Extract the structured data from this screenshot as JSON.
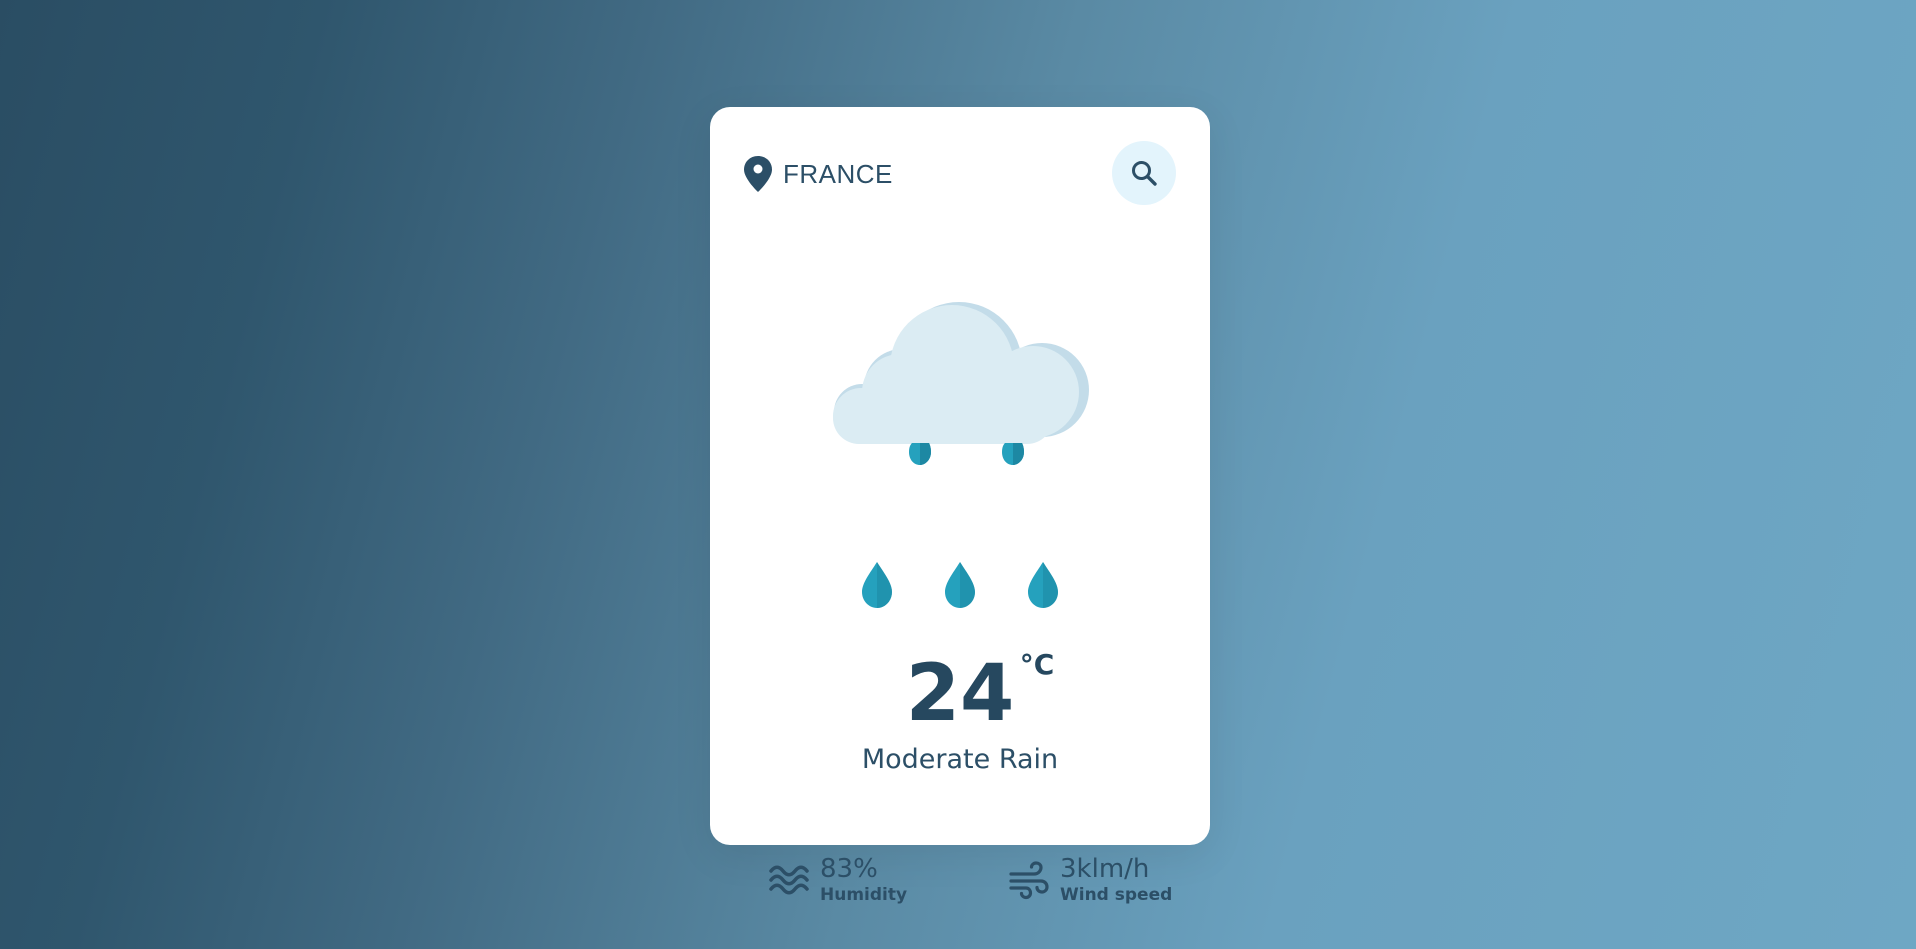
{
  "location": {
    "name": "FRANCE",
    "icon": "map-pin-icon"
  },
  "search": {
    "icon": "search-icon"
  },
  "weather": {
    "icon": "rain-cloud-icon",
    "temperature": "24",
    "unit": "°C",
    "description": "Moderate Rain"
  },
  "humidity": {
    "icon": "humidity-waves-icon",
    "value": "83%",
    "label": "Humidity"
  },
  "wind": {
    "icon": "wind-icon",
    "value": "3klm/h",
    "label": "Wind speed"
  },
  "colors": {
    "primary_text": "#2c4f67",
    "search_bg": "#e3f4fc",
    "cloud": "#dbecf3",
    "cloud_shadow": "#c3dce9",
    "raindrop": "#25a1bd",
    "raindrop_shade": "#1d88a3"
  }
}
